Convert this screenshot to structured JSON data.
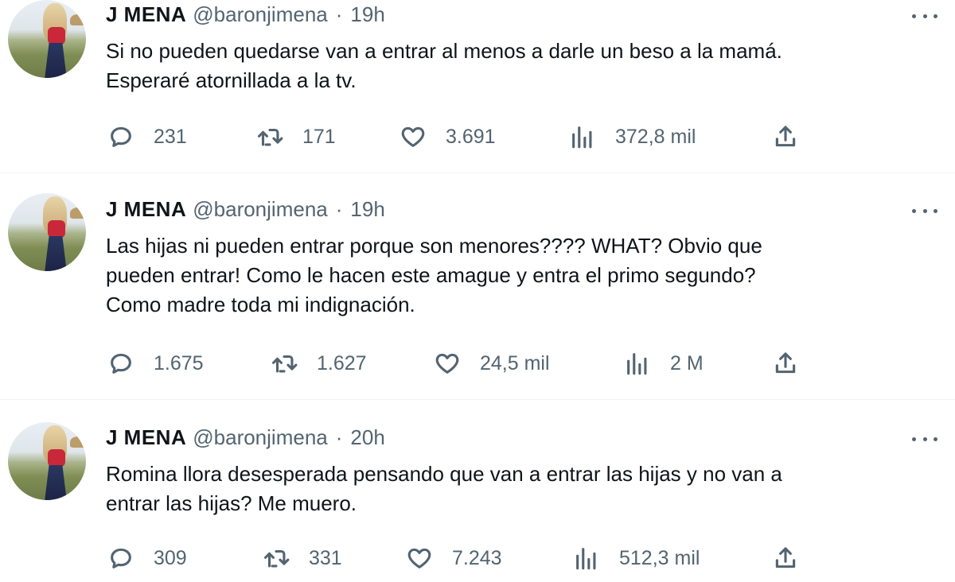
{
  "tweets": [
    {
      "display_name": "J MENA",
      "handle": "@baronjimena",
      "separator": "·",
      "time": "19h",
      "text": "Si no pueden quedarse van a entrar al menos a darle un beso a la mamá.\nEsperaré atornillada a la tv.",
      "replies": "231",
      "retweets": "171",
      "likes": "3.691",
      "views": "372,8 mil"
    },
    {
      "display_name": "J MENA",
      "handle": "@baronjimena",
      "separator": "·",
      "time": "19h",
      "text": "Las hijas ni pueden entrar porque son menores???? WHAT? Obvio que\npueden entrar! Como le hacen este amague y entra el primo segundo?\nComo madre toda mi indignación.",
      "replies": "1.675",
      "retweets": "1.627",
      "likes": "24,5 mil",
      "views": "2 M"
    },
    {
      "display_name": "J MENA",
      "handle": "@baronjimena",
      "separator": "·",
      "time": "20h",
      "text": "Romina llora desesperada pensando que van a entrar las hijas y no van a\nentrar las hijas? Me muero.",
      "replies": "309",
      "retweets": "331",
      "likes": "7.243",
      "views": "512,3 mil"
    }
  ],
  "icons": {
    "reply": "reply-icon",
    "retweet": "retweet-icon",
    "like": "heart-icon",
    "views": "views-icon",
    "share": "share-icon",
    "more": "more-options-icon"
  },
  "colors": {
    "text": "#0f1419",
    "secondary": "#536471",
    "divider": "#eff3f4"
  }
}
